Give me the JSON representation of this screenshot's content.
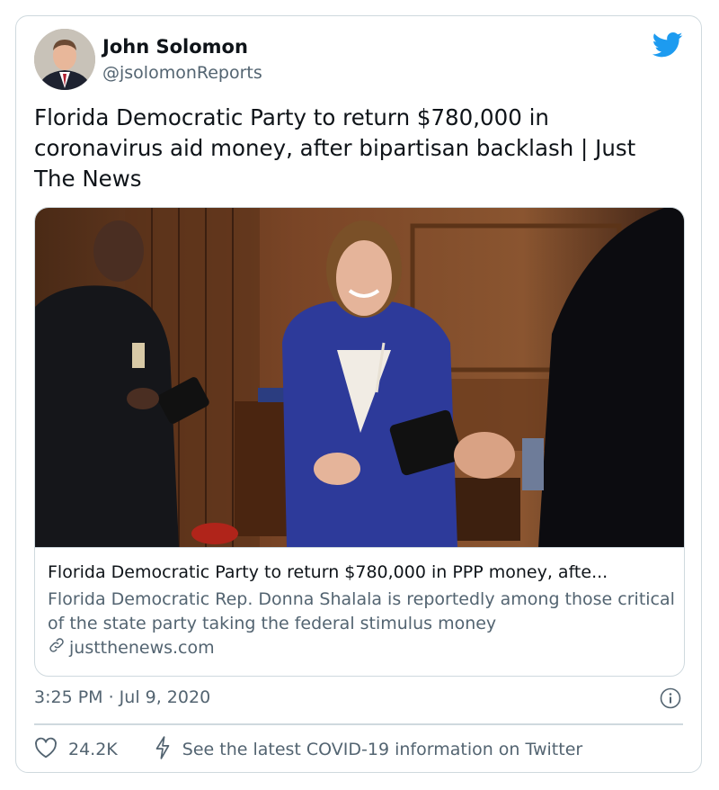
{
  "author": {
    "name": "John Solomon",
    "handle": "@jsolomonReports"
  },
  "tweet": {
    "text": "Florida Democratic Party to return $780,000 in coronavirus aid money, after bipartisan backlash | Just The News",
    "timestamp": "3:25 PM · Jul 9, 2020"
  },
  "link_card": {
    "title": "Florida Democratic Party to return $780,000 in PPP money, afte...",
    "description": "Florida Democratic Rep. Donna Shalala is reportedly among those critical of the state party taking the federal stimulus money",
    "domain": "justthenews.com"
  },
  "actions": {
    "likes": "24.2K",
    "covid_info": "See the latest COVID-19 information on Twitter"
  },
  "colors": {
    "twitter_blue": "#1d9bf0",
    "secondary_text": "#536471",
    "border": "#cfd9de"
  }
}
